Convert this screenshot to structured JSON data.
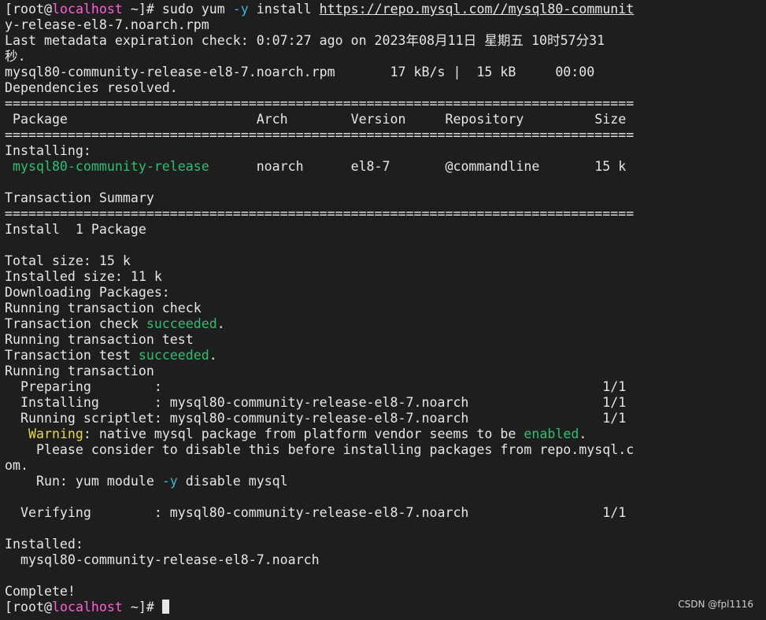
{
  "prompt": {
    "open": "[",
    "user": "root",
    "at": "@",
    "host": "localhost",
    "rest": " ~]# "
  },
  "command": {
    "pre": "sudo yum ",
    "flag": "-y",
    "mid": " install ",
    "url": "https://repo.mysql.com//mysql80-communit",
    "wrap": "y-release-el8-7.noarch.rpm"
  },
  "metadata_line1": "Last metadata expiration check: 0:07:27 ago on 2023年08月11日 星期五 10时57分31",
  "metadata_line2": "秒.",
  "download_line": "mysql80-community-release-el8-7.noarch.rpm       17 kB/s |  15 kB     00:00",
  "deps_resolved": "Dependencies resolved.",
  "separator": "================================================================================",
  "table_header": " Package                        Arch        Version     Repository         Size",
  "installing_label": "Installing:",
  "pkg_row": {
    "name": " mysql80-community-release",
    "rest": "      noarch      el8-7       @commandline       15 k"
  },
  "txn_summary": "Transaction Summary",
  "install_count": "Install  1 Package",
  "total_size": "Total size: 15 k",
  "installed_size": "Installed size: 11 k",
  "downloading": "Downloading Packages:",
  "running_check": "Running transaction check",
  "check_ok": {
    "pre": "Transaction check ",
    "word": "succeeded",
    "post": "."
  },
  "running_test": "Running transaction test",
  "test_ok": {
    "pre": "Transaction test ",
    "word": "succeeded",
    "post": "."
  },
  "running_txn": "Running transaction",
  "preparing": "  Preparing        :                                                        1/1",
  "installing_step": "  Installing       : mysql80-community-release-el8-7.noarch                 1/1",
  "scriptlet": "  Running scriptlet: mysql80-community-release-el8-7.noarch                 1/1",
  "warning": {
    "indent": "   ",
    "label": "Warning",
    "text": ": native mysql package from platform vendor seems to be ",
    "word": "enabled",
    "post": "."
  },
  "consider_line1": "    Please consider to disable this before installing packages from repo.mysql.c",
  "consider_line2": "om.",
  "run_cmd": {
    "pre": "    Run: yum module ",
    "flag": "-y",
    "post": " disable mysql"
  },
  "verifying": "  Verifying        : mysql80-community-release-el8-7.noarch                 1/1",
  "installed_label": "Installed:",
  "installed_pkg": "  mysql80-community-release-el8-7.noarch",
  "complete": "Complete!",
  "watermark": "CSDN @fpl1116"
}
